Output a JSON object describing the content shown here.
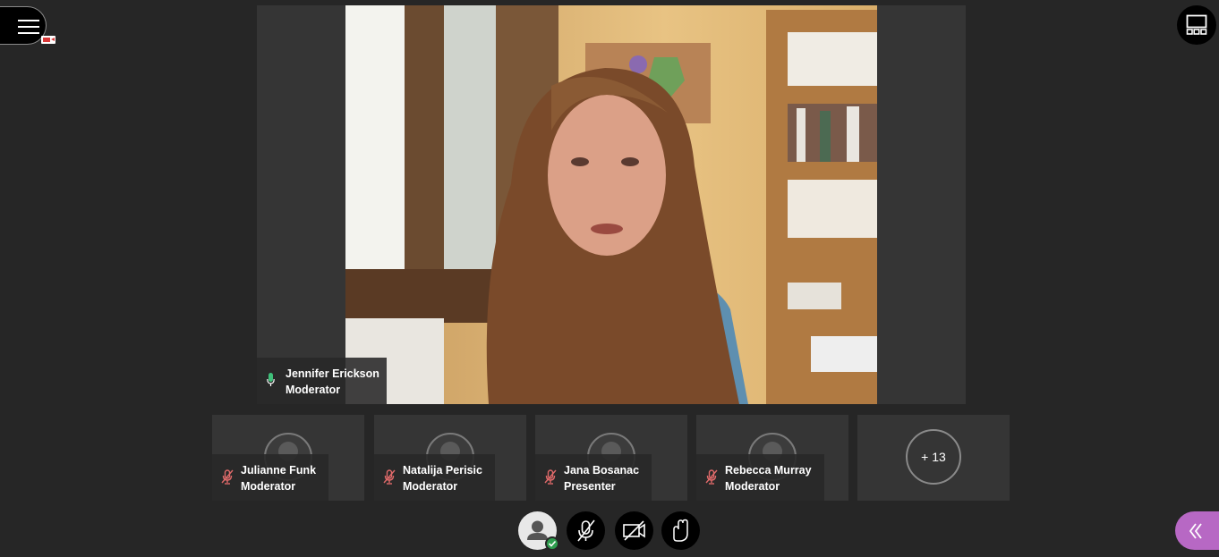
{
  "window": {
    "menu_icon": "hamburger-icon",
    "camera_status_icon": "camera-active-icon",
    "layout_icon": "layout-icon"
  },
  "stage": {
    "speaker_name": "Jennifer Erickson",
    "speaker_role": "Moderator",
    "speaker_mic": "mic-on-icon"
  },
  "participants": [
    {
      "name": "Julianne Funk",
      "role": "Moderator",
      "mic": "mic-muted-icon"
    },
    {
      "name": "Natalija Perisic",
      "role": "Moderator",
      "mic": "mic-muted-icon"
    },
    {
      "name": "Jana Bosanac",
      "role": "Presenter",
      "mic": "mic-muted-icon"
    },
    {
      "name": "Rebecca Murray",
      "role": "Moderator",
      "mic": "mic-muted-icon"
    }
  ],
  "more_participants": "+ 13",
  "controls": {
    "status_icon": "avatar-status-icon",
    "audio_icon": "mic-muted-icon",
    "video_icon": "camera-off-icon",
    "hand_icon": "raise-hand-icon",
    "panel_icon": "double-chevron-left-icon"
  },
  "colors": {
    "background": "#262626",
    "tile": "#353535",
    "accent": "#b768c4",
    "muted": "#e06a6a",
    "active_mic": "#3fc07a",
    "status_ok": "#2e9e4e"
  }
}
